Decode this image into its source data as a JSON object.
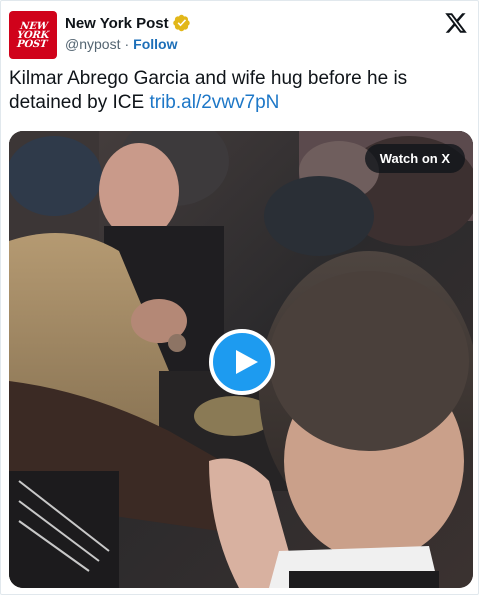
{
  "account": {
    "name": "New York Post",
    "handle": "@nypost",
    "separator": "·",
    "follow_label": "Follow",
    "avatar_text": [
      "NEW",
      "YORK",
      "POST"
    ]
  },
  "tweet": {
    "text": "Kilmar Abrego Garcia and wife hug before he is detained by ICE ",
    "link_text": "trib.al/2vwv7pN"
  },
  "media": {
    "watch_label": "Watch on X"
  },
  "colors": {
    "brand_red": "#d0021b",
    "link_blue": "#1d77c7",
    "play_blue": "#1d9bf0",
    "verified_gold": "#e2b719"
  },
  "icons": [
    "verified-badge-icon",
    "x-logo-icon",
    "play-icon"
  ]
}
